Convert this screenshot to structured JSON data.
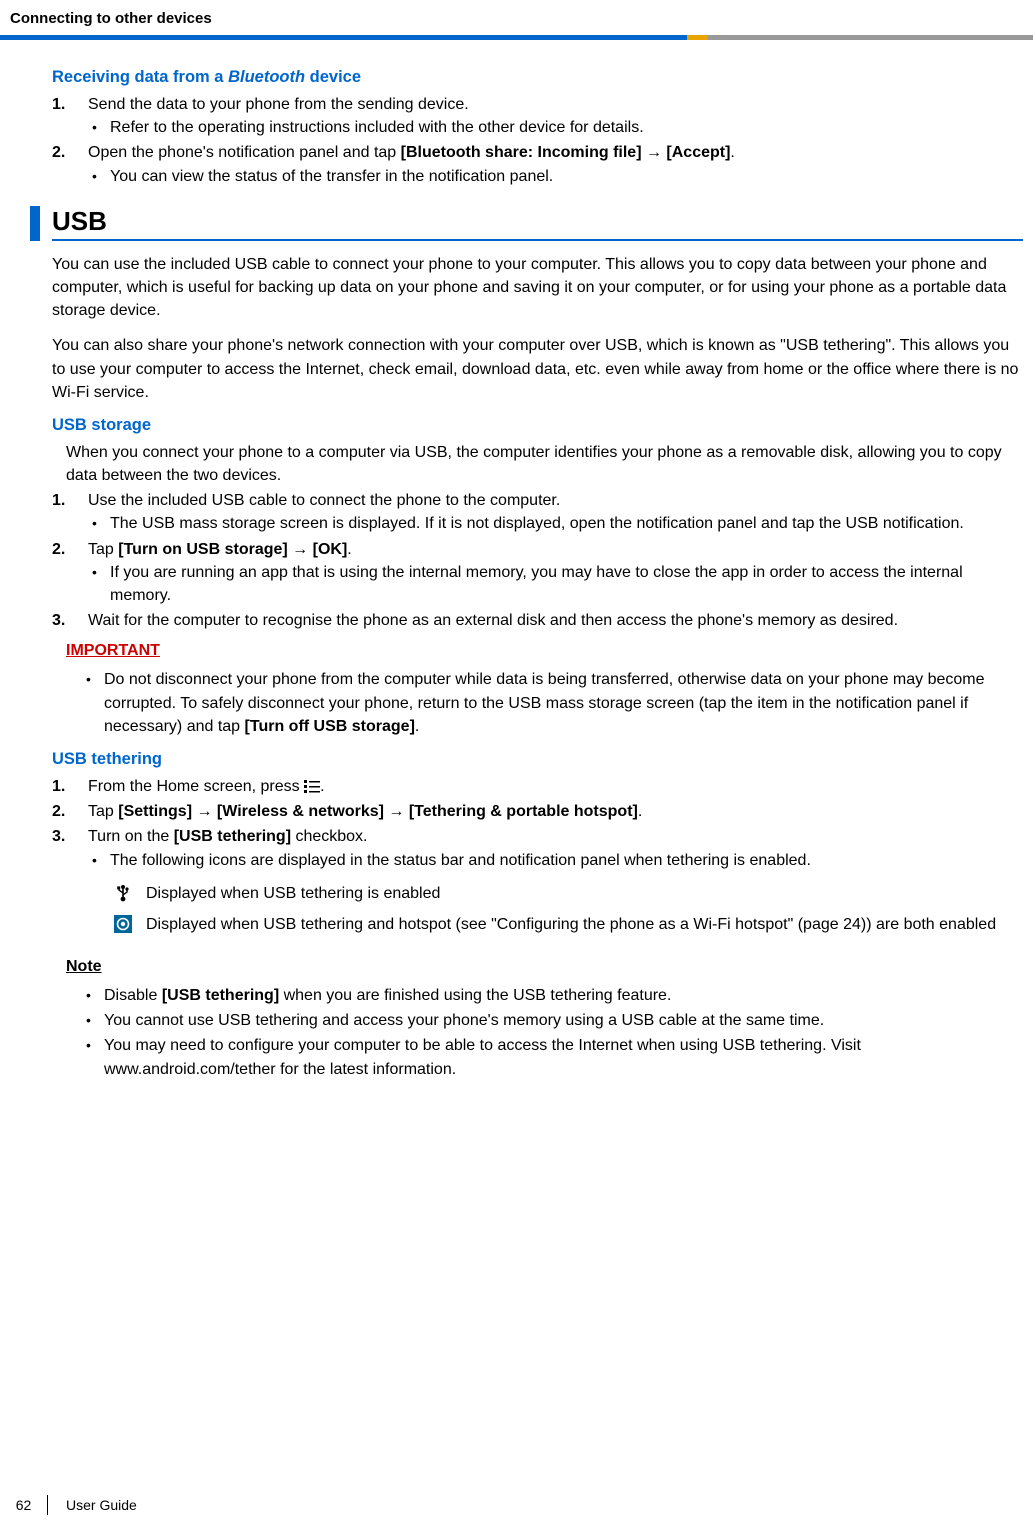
{
  "header": "Connecting to other devices",
  "receiving_title_pre": "Receiving data from a ",
  "receiving_title_italic": "Bluetooth",
  "receiving_title_post": " device",
  "recv_step1": "Send the data to your phone from the sending device.",
  "recv_step1_b1": "Refer to the operating instructions included with the other device for details.",
  "recv_step2_pre": "Open the phone's notification panel and tap ",
  "recv_step2_b1": "[Bluetooth share: Incoming file]",
  "recv_step2_arrow": " → ",
  "recv_step2_b2": "[Accept]",
  "recv_step2_post": ".",
  "recv_step2_sub": "You can view the status of the transfer in the notification panel.",
  "usb_title": "USB",
  "usb_p1": "You can use the included USB cable to connect your phone to your computer. This allows you to copy data between your phone and computer, which is useful for backing up data on your phone and saving it on your computer, or for using your phone as a portable data storage device.",
  "usb_p2": "You can also share your phone's network connection with your computer over USB, which is known as \"USB tethering\". This allows you to use your computer to access the Internet, check email, download data, etc. even while away from home or the office where there is no Wi-Fi service.",
  "usb_storage_title": "USB storage",
  "usb_storage_intro": "When you connect your phone to a computer via USB, the computer identifies your phone as a removable disk, allowing you to copy data between the two devices.",
  "usbs_1": "Use the included USB cable to connect the phone to the computer.",
  "usbs_1_b": "The USB mass storage screen is displayed. If it is not displayed, open the notification panel and tap the USB notification.",
  "usbs_2_pre": "Tap ",
  "usbs_2_b1": "[Turn on USB storage]",
  "usbs_2_arrow": " → ",
  "usbs_2_b2": "[OK]",
  "usbs_2_post": ".",
  "usbs_2_sub": "If you are running an app that is using the internal memory, you may have to close the app in order to access the internal memory.",
  "usbs_3": "Wait for the computer to recognise the phone as an external disk and then access the phone's memory as desired.",
  "important_label": "IMPORTANT",
  "important_text_pre": "Do not disconnect your phone from the computer while data is being transferred, otherwise data on your phone may become corrupted. To safely disconnect your phone, return to the USB mass storage screen (tap the item in the notification panel if necessary) and tap ",
  "important_text_b": "[Turn off USB storage]",
  "important_text_post": ".",
  "usb_tether_title": "USB tethering",
  "tether_1_pre": "From the Home screen, press ",
  "tether_1_post": ".",
  "tether_2_pre": "Tap ",
  "tether_2_b1": "[Settings]",
  "tether_2_a1": " → ",
  "tether_2_b2": "[Wireless & networks]",
  "tether_2_a2": " → ",
  "tether_2_b3": "[Tethering & portable hotspot]",
  "tether_2_post": ".",
  "tether_3_pre": "Turn on the ",
  "tether_3_b": "[USB tethering]",
  "tether_3_post": " checkbox.",
  "tether_3_sub": "The following icons are displayed in the status bar and notification panel when tethering is enabled.",
  "icon1_text": "Displayed when USB tethering is enabled",
  "icon2_text": "Displayed when USB tethering and hotspot (see \"Configuring the phone as a Wi-Fi hotspot\" (page 24)) are both enabled",
  "note_label": "Note",
  "note_b1_pre": "Disable ",
  "note_b1_b": "[USB tethering]",
  "note_b1_post": " when you are finished using the USB tethering feature.",
  "note_b2": "You cannot use USB tethering and access your phone's memory using a USB cable at the same time.",
  "note_b3": "You may need to configure your computer to be able to access the Internet when using USB tethering. Visit www.android.com/tether for the latest information.",
  "page_no": "62",
  "guide_label": "User Guide"
}
